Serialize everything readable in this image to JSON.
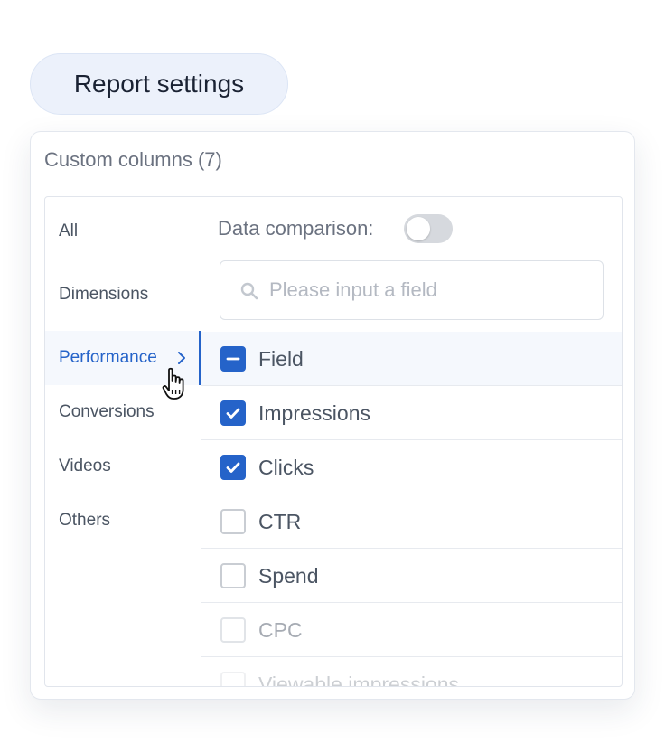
{
  "header": {
    "report_settings_label": "Report settings"
  },
  "panel": {
    "title": "Custom columns (7)"
  },
  "categories": [
    {
      "label": "All",
      "active": false
    },
    {
      "label": "Dimensions",
      "active": false
    },
    {
      "label": "Performance",
      "active": true
    },
    {
      "label": "Conversions",
      "active": false
    },
    {
      "label": "Videos",
      "active": false
    },
    {
      "label": "Others",
      "active": false
    }
  ],
  "comparison": {
    "label": "Data comparison:",
    "enabled": false
  },
  "search": {
    "placeholder": "Please input a field",
    "value": ""
  },
  "fields": [
    {
      "label": "Field",
      "state": "indeterminate"
    },
    {
      "label": "Impressions",
      "state": "checked"
    },
    {
      "label": "Clicks",
      "state": "checked"
    },
    {
      "label": "CTR",
      "state": "unchecked"
    },
    {
      "label": "Spend",
      "state": "unchecked"
    },
    {
      "label": "CPC",
      "state": "disabled"
    },
    {
      "label": "Viewable impressions",
      "state": "faded"
    }
  ],
  "colors": {
    "accent": "#2563c9",
    "button_bg": "#ecf1fb",
    "text_muted": "#6b7280"
  },
  "icons": {
    "search": "search-icon",
    "chevron": "chevron-right-icon",
    "cursor": "hand-pointer-icon",
    "check": "check-icon",
    "minus": "minus-icon"
  }
}
